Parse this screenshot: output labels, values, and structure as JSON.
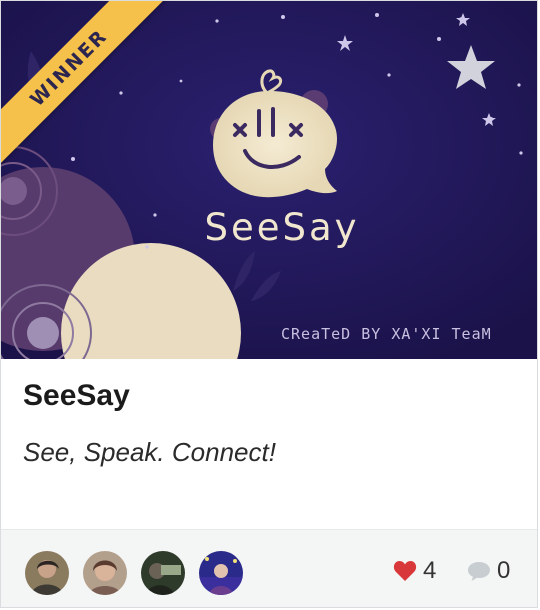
{
  "card": {
    "badge": "WINNER",
    "thumbnail_title": "SeeSay",
    "thumbnail_credit": "CReaTeD BY XA'XI TeaM",
    "title": "SeeSay",
    "tagline": "See, Speak. Connect!",
    "likes": "4",
    "comments": "0",
    "members": [
      {
        "name": "member-1"
      },
      {
        "name": "member-2"
      },
      {
        "name": "member-3"
      },
      {
        "name": "member-4"
      }
    ]
  },
  "colors": {
    "background_dark": "#22185a",
    "ribbon": "#f6c14a",
    "heart": "#d9383a",
    "footer": "#f4f5f5"
  },
  "icons": [
    "star-icon",
    "heart-icon",
    "comment-icon"
  ]
}
